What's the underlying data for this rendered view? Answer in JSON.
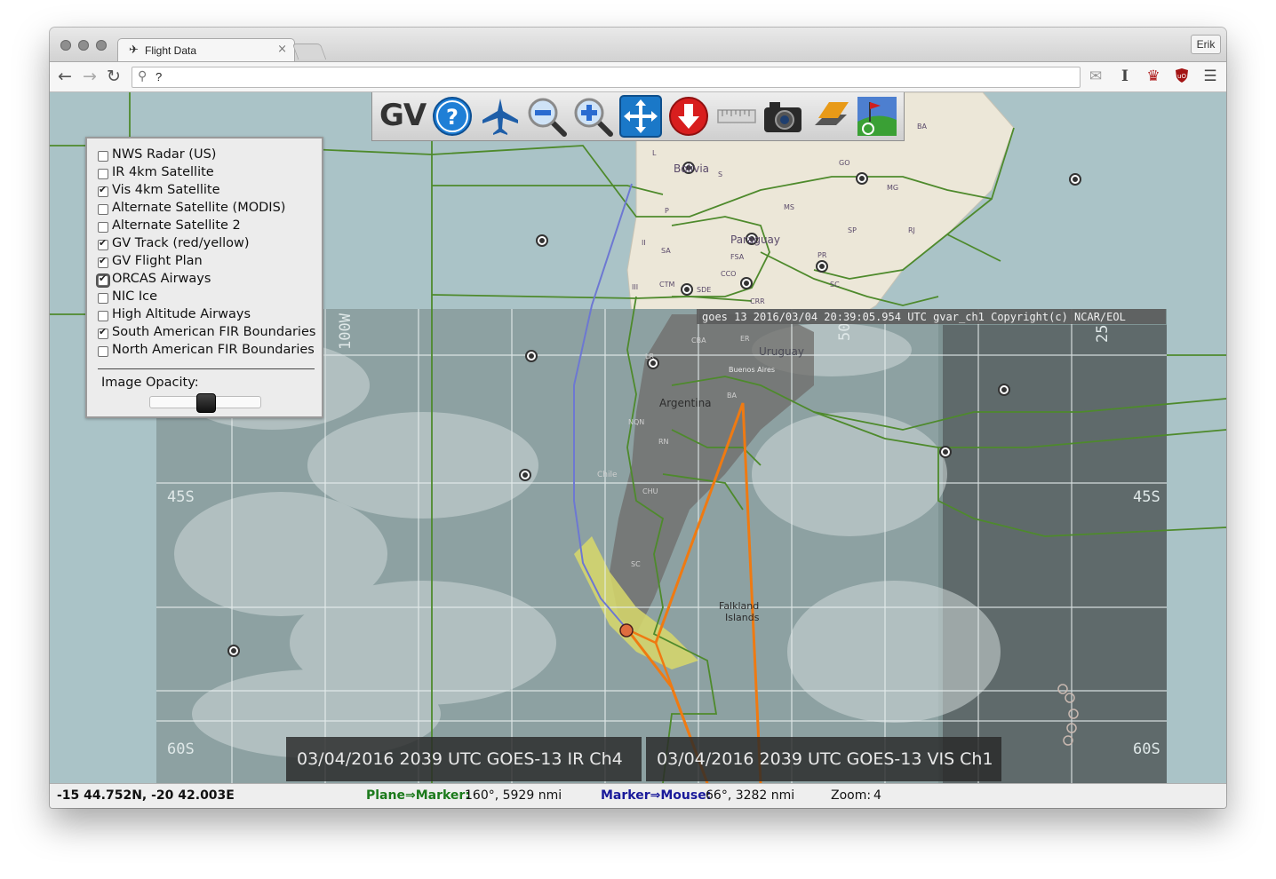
{
  "browser": {
    "tab_title": "Flight Data",
    "tab_close": "×",
    "profile_name": "Erik",
    "address_value": "?",
    "nav": {
      "back": "←",
      "forward": "→",
      "reload": "↻"
    },
    "extensions": [
      "mail-icon",
      "instapaper-icon",
      "hat-icon",
      "ublock-icon",
      "menu-icon"
    ]
  },
  "toolbar": {
    "logo": "GV",
    "tools": [
      {
        "name": "help-icon",
        "color": "#1f7fd6"
      },
      {
        "name": "airplane-icon",
        "color": "#1e5ea8"
      },
      {
        "name": "zoom-out-icon",
        "color": "#2a6bd0"
      },
      {
        "name": "zoom-in-icon",
        "color": "#2a6bd0"
      },
      {
        "name": "pan-icon",
        "color": "#1a78c8"
      },
      {
        "name": "down-arrow-icon",
        "color": "#d81e1e"
      },
      {
        "name": "ruler-icon",
        "color": "#b8b8b8"
      },
      {
        "name": "camera-icon",
        "color": "#222222"
      },
      {
        "name": "layers-icon",
        "color": "#e89a18"
      },
      {
        "name": "map-flag-icon",
        "color": "#3aa035"
      }
    ]
  },
  "layers": {
    "items": [
      {
        "label": "NWS Radar (US)",
        "checked": false
      },
      {
        "label": "IR 4km Satellite",
        "checked": false
      },
      {
        "label": "Vis 4km Satellite",
        "checked": true
      },
      {
        "label": "Alternate Satellite (MODIS)",
        "checked": false
      },
      {
        "label": "Alternate Satellite 2",
        "checked": false
      },
      {
        "label": "GV Track (red/yellow)",
        "checked": true
      },
      {
        "label": "GV Flight Plan",
        "checked": true
      },
      {
        "label": "ORCAS Airways",
        "checked": true
      },
      {
        "label": "NIC Ice",
        "checked": false
      },
      {
        "label": "High Altitude Airways",
        "checked": false
      },
      {
        "label": "South American FIR Boundaries",
        "checked": true
      },
      {
        "label": "North American FIR Boundaries",
        "checked": false
      }
    ],
    "opacity_label": "Image Opacity:",
    "opacity_value": 0.5
  },
  "map": {
    "image_caption": "goes 13 2016/03/04 20:39:05.954 UTC gvar_ch1 Copyright(c) NCAR/EOL",
    "grid_labels": {
      "lon_left": "100W",
      "lon_right": "25",
      "lat_45_left": "45S",
      "lat_45_right": "45S",
      "lat_60_left": "60S",
      "lat_60_right": "60S",
      "lon_mid": "50"
    },
    "place_labels": [
      "Bolivia",
      "Paraguay",
      "Uruguay",
      "Argentina",
      "Falkland Islands",
      "Buenos Aires",
      "Chile",
      "GO",
      "MG",
      "MS",
      "PR",
      "SC",
      "RJ",
      "SP",
      "SA",
      "FSA",
      "CCO",
      "CRR",
      "CTM",
      "SDE",
      "CBA",
      "ER",
      "BA",
      "NQN",
      "RN",
      "CHU",
      "SC",
      "LR",
      "III",
      "II",
      "P",
      "L",
      "S",
      "BA"
    ],
    "overlays": {
      "ir_caption": "03/04/2016 2039 UTC GOES-13 IR Ch4",
      "vis_caption": "03/04/2016 2039 UTC GOES-13 VIS Ch1"
    }
  },
  "status": {
    "coords": "-15 44.752N, -20 42.003E",
    "plane_marker_label": "Plane⇒Marker:",
    "plane_marker_value": "160°, 5929 nmi",
    "marker_mouse_label": "Marker⇒Mouse:",
    "marker_mouse_value": "66°, 3282 nmi",
    "zoom_label": "Zoom:",
    "zoom_value": "4"
  }
}
